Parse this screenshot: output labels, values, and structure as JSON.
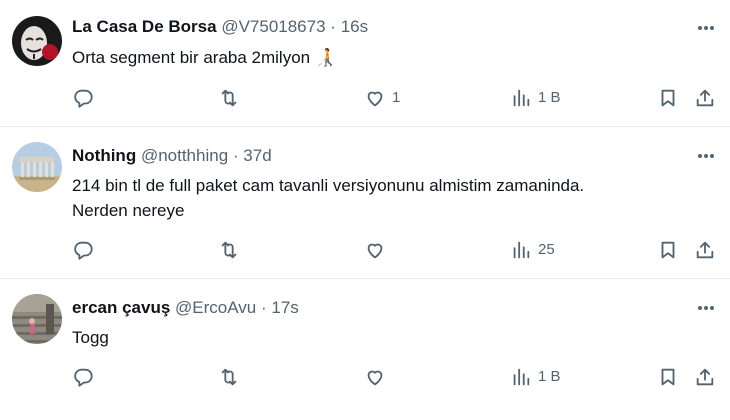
{
  "tweets": [
    {
      "name": "La Casa De Borsa",
      "handle": "@V75018673",
      "separator": "·",
      "time": "16s",
      "text": "Orta segment bir araba 2milyon",
      "text_emoji": "🧑‍🦯",
      "replies": "",
      "retweets": "",
      "likes": "1",
      "views": "1 B"
    },
    {
      "name": "Nothing",
      "handle": "@notthhing",
      "separator": "·",
      "time": "37d",
      "text_line1": "214 bin tl de full paket cam tavanli versiyonunu almistim zamaninda.",
      "text_line2": "Nerden nereye",
      "replies": "",
      "retweets": "",
      "likes": "",
      "views": "25"
    },
    {
      "name": "ercan çavuş",
      "handle": "@ErcoAvu",
      "separator": "·",
      "time": "17s",
      "text": "Togg",
      "replies": "",
      "retweets": "",
      "likes": "",
      "views": "1 B"
    }
  ],
  "icons": {
    "more": "more-horizontal-icon",
    "reply": "reply-icon",
    "retweet": "retweet-icon",
    "like": "heart-icon",
    "views": "views-bar-chart-icon",
    "bookmark": "bookmark-icon",
    "share": "share-icon"
  },
  "colors": {
    "text_primary": "#0f1419",
    "text_secondary": "#536471",
    "divider": "#e8ecef"
  }
}
